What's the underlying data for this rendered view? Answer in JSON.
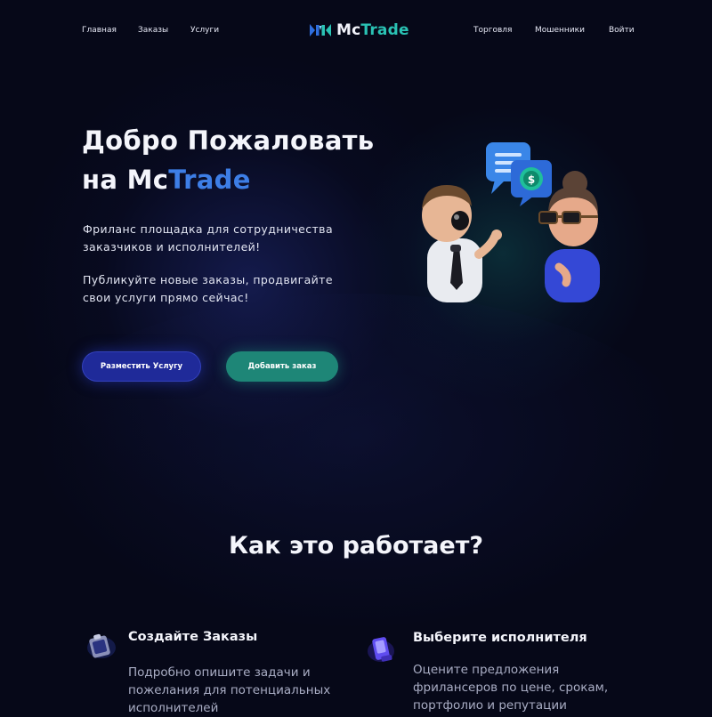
{
  "nav": {
    "left": [
      "Главная",
      "Заказы",
      "Услуги"
    ],
    "right": [
      "Торговля",
      "Мошенники",
      "Войти"
    ]
  },
  "logo": {
    "part1": "Mc",
    "part2": "Trade"
  },
  "hero": {
    "title_line1": "Добро Пожаловать",
    "title_line2_prefix": "на Mc",
    "title_line2_accent": "Trade",
    "p1_line1": "Фриланс площадка для сотрудничества",
    "p1_line2": "заказчиков и исполнителей!",
    "p2_line1": "Публикуйте новые заказы, продвигайте",
    "p2_line2": "свои услуги прямо сейчас!"
  },
  "buttons": {
    "primary": "Разместить Услугу",
    "secondary": "Добавить заказ"
  },
  "how": {
    "title": "Как это работает?",
    "features": [
      {
        "title": "Создайте Заказы",
        "desc_lines": [
          "Подробно опишите задачи и",
          "пожелания для потенциальных",
          "исполнителей"
        ],
        "icon": "clipboard-icon"
      },
      {
        "title": "Выберите исполнителя",
        "desc_lines": [
          "Оцените предложения",
          "фрилансеров по цене, срокам,",
          "портфолио и репутации"
        ],
        "icon": "document-icon"
      }
    ]
  },
  "colors": {
    "background": "#060818",
    "primary_button": "#1f2a99",
    "secondary_button": "#1e8677",
    "accent_teal": "#2ac2b4",
    "accent_blue": "#3d7ee6"
  }
}
